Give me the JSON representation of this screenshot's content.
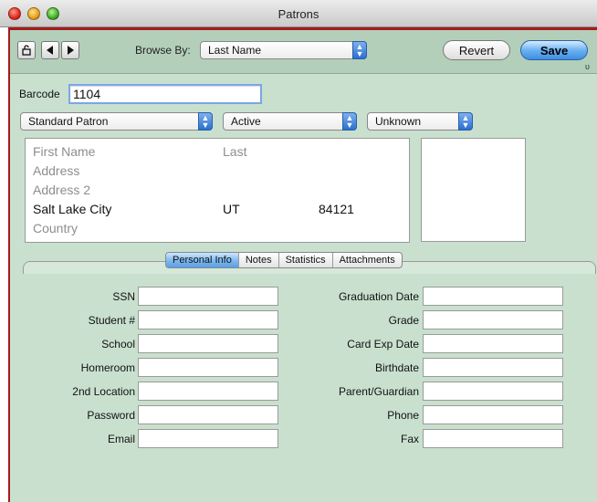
{
  "window": {
    "title": "Patrons"
  },
  "toolbar": {
    "browse_label": "Browse By:",
    "browse_value": "Last Name",
    "revert_label": "Revert",
    "save_label": "Save",
    "small_mark": "υ"
  },
  "barcode": {
    "label": "Barcode",
    "value": "1104"
  },
  "popups": {
    "patron_type": "Standard Patron",
    "status": "Active",
    "gender": "Unknown"
  },
  "address": {
    "first_name": "First Name",
    "last": "Last",
    "address": "Address",
    "address2": "Address 2",
    "city": "Salt Lake City",
    "state": "UT",
    "zip": "84121",
    "country": "Country"
  },
  "tabs": [
    "Personal Info",
    "Notes",
    "Statistics",
    "Attachments"
  ],
  "form_left": [
    "SSN",
    "Student #",
    "School",
    "Homeroom",
    "2nd Location",
    "Password",
    "Email"
  ],
  "form_right": [
    "Graduation Date",
    "Grade",
    "Card Exp Date",
    "Birthdate",
    "Parent/Guardian",
    "Phone",
    "Fax"
  ],
  "colors": {
    "panel": "#c9e0cf",
    "accent_border": "#a51a1a",
    "focus": "#7aa7e6"
  },
  "icons": [
    "lock-icon",
    "back-arrow-icon",
    "forward-arrow-icon",
    "popup-arrows-icon"
  ]
}
